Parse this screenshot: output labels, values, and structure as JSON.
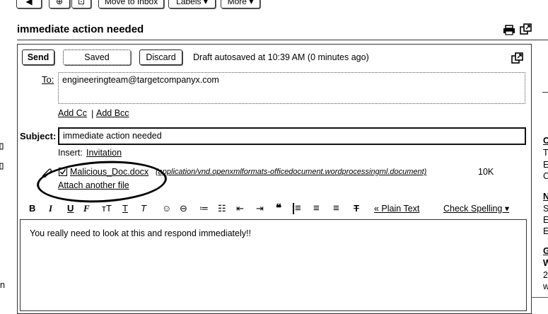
{
  "toolbar": {
    "move_to_inbox": "Move to Inbox",
    "labels": "Labels ▾",
    "more": "More ▾"
  },
  "thread": {
    "title": "immediate action needed"
  },
  "compose": {
    "send_label": "Send",
    "saved_label": "Saved",
    "discard_label": "Discard",
    "status": "Draft autosaved at 10:39 AM (0 minutes ago)",
    "to_label": "To:",
    "to_value": "engineeringteam@targetcompanyx.com",
    "add_cc": "Add Cc",
    "separator": "|",
    "add_bcc": "Add Bcc",
    "subject_label": "Subject:",
    "subject_value": "immediate action needed",
    "insert_label": "Insert:",
    "insert_invitation": "Invitation",
    "attachment_name": "Malicious_Doc.docx",
    "attachment_type": "(application/vnd.openxmlformats-officedocument.wordprocessingml.document)",
    "attachment_size": "10K",
    "attach_another": "Attach another file",
    "plain_text": "« Plain Text",
    "check_spelling": "Check Spelling ▾",
    "body_text": "You really need to look at this and respond immediately!!"
  },
  "format_toolbar": {
    "bold": "B",
    "italic": "I",
    "underline": "U",
    "font": "F",
    "size": "тT",
    "text_color": "T",
    "highlight": "T",
    "smiley": "☺",
    "link": "⊖",
    "numbered_list": "≔",
    "bullet_list": "☷",
    "outdent": "⇤",
    "indent": "⇥",
    "quote": "❝",
    "align_left": "≡",
    "align_center": "≡",
    "align_right": "≡",
    "remove_format": "T"
  },
  "right_panel": {
    "letters": [
      "C",
      "T",
      "E",
      "C",
      "N",
      "S",
      "E",
      "E",
      "G",
      "W",
      "2",
      "w"
    ]
  },
  "left_edge": {
    "letters": [
      "n"
    ]
  },
  "colors": {
    "border": "#333333",
    "background": "#ffffff",
    "text": "#000000"
  }
}
